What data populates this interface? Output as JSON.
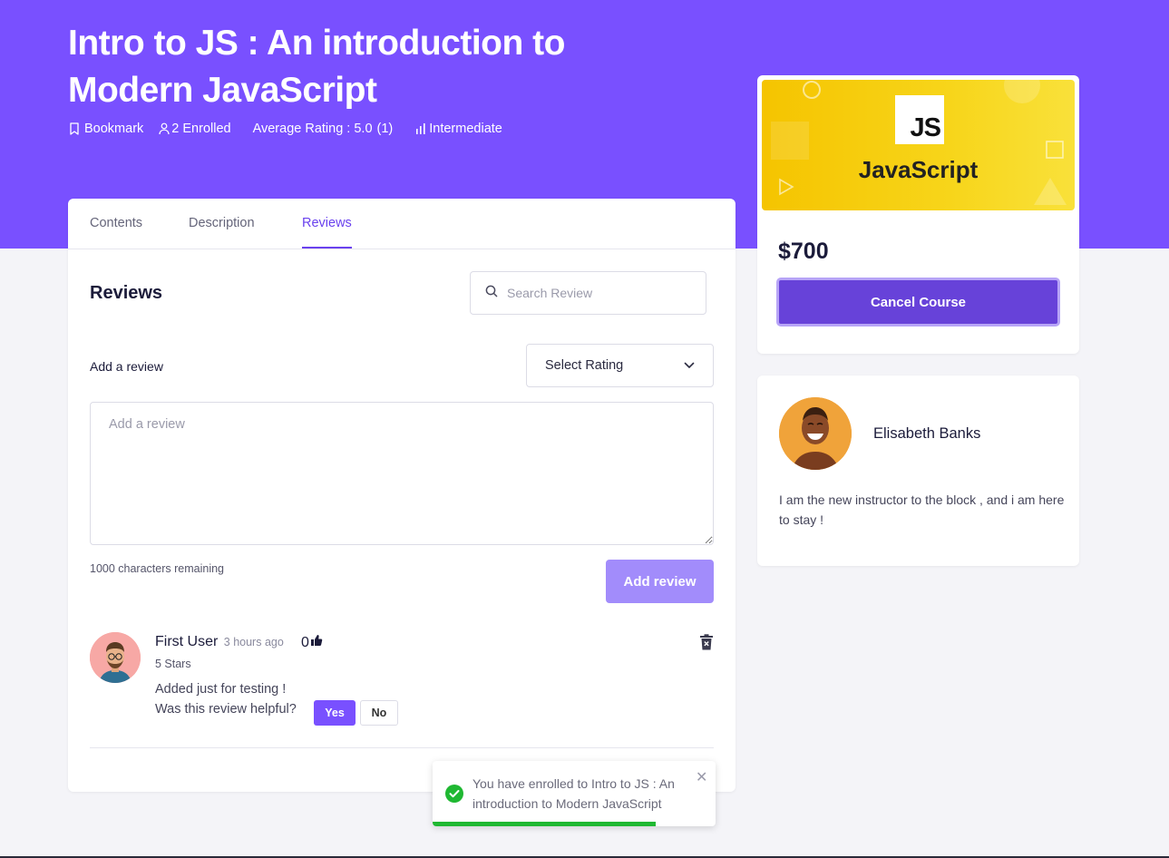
{
  "colors": {
    "hero_bg": "#7950ff",
    "accent": "#6a42ee",
    "add_review_btn": "#a28cfb",
    "cancel_btn": "#6742d9",
    "toast_progress": "#1fb832"
  },
  "course": {
    "title": "Intro to JS : An introduction to Modern JavaScript",
    "meta": {
      "bookmark": "Bookmark",
      "enrolled": "2 Enrolled",
      "rating": "Average Rating : 5.0",
      "rating_count": "(1)",
      "level": "Intermediate"
    }
  },
  "tabs": [
    {
      "label": "Contents",
      "active": false
    },
    {
      "label": "Description",
      "active": false
    },
    {
      "label": "Reviews",
      "active": true
    }
  ],
  "reviews_section": {
    "heading": "Reviews",
    "search_placeholder": "Search Review",
    "add_label": "Add a review",
    "select_rating": "Select Rating",
    "textarea_placeholder": "Add a review",
    "chars_remaining": "1000 characters remaining",
    "add_button": "Add review"
  },
  "review": {
    "author": "First User",
    "time": "3 hours ago",
    "likes": "0",
    "stars": "5 Stars",
    "text": "Added just for testing !",
    "helpful_q": "Was this review helpful?",
    "yes": "Yes",
    "no": "No"
  },
  "sidebar": {
    "image_logo_text": "JS",
    "image_caption": "JavaScript",
    "price": "$700",
    "cancel_button": "Cancel Course"
  },
  "instructor": {
    "name": "Elisabeth Banks",
    "bio": "I am the new instructor to the block , and i am here to stay !"
  },
  "toast": {
    "message": "You have enrolled to Intro to JS : An introduction to Modern JavaScript",
    "progress": 0.79
  },
  "icons": [
    "bookmark-icon",
    "user-icon",
    "bar-chart-icon",
    "search-icon",
    "chevron-down-icon",
    "thumbs-up-icon",
    "trash-icon",
    "check-circle-icon",
    "close-icon"
  ]
}
